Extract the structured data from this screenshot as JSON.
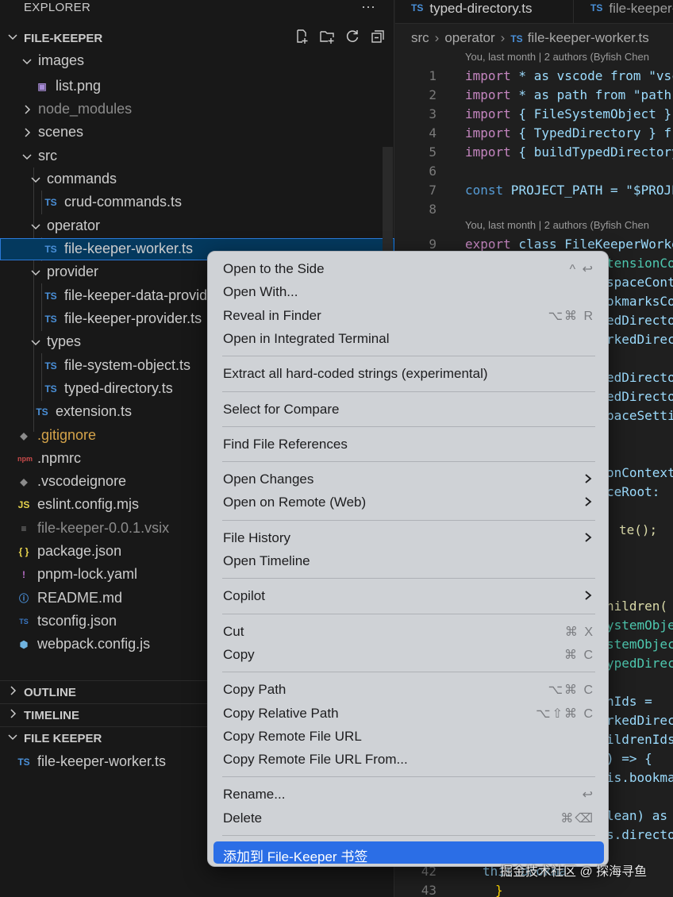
{
  "explorer": {
    "title": "EXPLORER",
    "more_label": "···",
    "root_label": "FILE-KEEPER",
    "tree": [
      {
        "label": "images",
        "type": "folder-open"
      },
      {
        "label": "list.png",
        "type": "image"
      },
      {
        "label": "node_modules",
        "type": "folder-closed",
        "dim": true
      },
      {
        "label": "scenes",
        "type": "folder-closed"
      },
      {
        "label": "src",
        "type": "folder-open"
      },
      {
        "label": "commands",
        "type": "folder-open"
      },
      {
        "label": "crud-commands.ts",
        "type": "ts"
      },
      {
        "label": "operator",
        "type": "folder-open"
      },
      {
        "label": "file-keeper-worker.ts",
        "type": "ts",
        "selected": true
      },
      {
        "label": "provider",
        "type": "folder-open"
      },
      {
        "label": "file-keeper-data-provider.ts",
        "type": "ts"
      },
      {
        "label": "file-keeper-provider.ts",
        "type": "ts"
      },
      {
        "label": "types",
        "type": "folder-open"
      },
      {
        "label": "file-system-object.ts",
        "type": "ts"
      },
      {
        "label": "typed-directory.ts",
        "type": "ts"
      },
      {
        "label": "extension.ts",
        "type": "ts"
      },
      {
        "label": ".gitignore",
        "type": "git"
      },
      {
        "label": ".npmrc",
        "type": "npm"
      },
      {
        "label": ".vscodeignore",
        "type": "git-gray"
      },
      {
        "label": "eslint.config.mjs",
        "type": "js"
      },
      {
        "label": "file-keeper-0.0.1.vsix",
        "type": "text",
        "dim": true
      },
      {
        "label": "package.json",
        "type": "json"
      },
      {
        "label": "pnpm-lock.yaml",
        "type": "yaml"
      },
      {
        "label": "README.md",
        "type": "info"
      },
      {
        "label": "tsconfig.json",
        "type": "tsconfig"
      },
      {
        "label": "webpack.config.js",
        "type": "webpack"
      }
    ],
    "icon_text": {
      "ts": "TS",
      "js": "JS",
      "json": "{ }",
      "yaml": "!",
      "info": "ⓘ",
      "text": "≡",
      "npm": "npm",
      "git": "◆",
      "tsconfig": "TS",
      "webpack": "⬢",
      "image": "▣"
    },
    "sections": {
      "outline": "OUTLINE",
      "timeline": "TIMELINE",
      "file_keeper": "FILE KEEPER",
      "file_keeper_item": "file-keeper-worker.ts"
    }
  },
  "editor": {
    "tabs": [
      {
        "badge": "TS",
        "label": "typed-directory.ts"
      },
      {
        "badge": "TS",
        "label": "file-keeper-worker.ts"
      }
    ],
    "breadcrumb": [
      "src",
      "operator",
      "file-keeper-worker.ts"
    ],
    "breadcrumb_badge": "TS",
    "blame": "You, last month | 2 authors (Byfish Chen",
    "lines": [
      {
        "n": "1",
        "kw": "import",
        "rest": " * as vscode from \"vsc"
      },
      {
        "n": "2",
        "kw": "import",
        "rest": " * as path from \"path\""
      },
      {
        "n": "3",
        "kw": "import",
        "rest": " { FileSystemObject }"
      },
      {
        "n": "4",
        "kw": "import",
        "rest": " { TypedDirectory } f"
      },
      {
        "n": "5",
        "kw": "import",
        "rest": " { buildTypedDirectory"
      },
      {
        "n": "6",
        "kw": "",
        "rest": ""
      },
      {
        "n": "7",
        "kw": "const",
        "rest": " PROJECT_PATH = \"$PROJE"
      },
      {
        "n": "8",
        "kw": "",
        "rest": ""
      },
      {
        "n": "9",
        "kw": "export",
        "rest": " class FileKeeperWorke"
      }
    ],
    "peek_fragments": [
      "tensionCo",
      "spaceCont",
      "okmarksCo",
      "edDirecto",
      "rkedDirec",
      "edDirecto",
      "edDirecto",
      "paceSetti",
      "onContext",
      "ceRoot:",
      "te();",
      "hildren(",
      "ystemObje",
      "stemObjec",
      "ypedDirec",
      "nIds =",
      "rkedDirec",
      "ildrenIds",
      ") => {",
      "is.bookma",
      "lean) as",
      "s.directo"
    ],
    "bottom_lines": [
      {
        "n": "42",
        "text": "this.bookma"
      },
      {
        "n": "43",
        "text": "}"
      }
    ]
  },
  "context_menu": {
    "items": [
      {
        "label": "Open to the Side",
        "shortcut": "^ ↩"
      },
      {
        "label": "Open With...",
        "shortcut": ""
      },
      {
        "label": "Reveal in Finder",
        "shortcut": "⌥⌘ R"
      },
      {
        "label": "Open in Integrated Terminal",
        "shortcut": ""
      },
      {
        "sep": true
      },
      {
        "label": "Extract all hard-coded strings (experimental)",
        "shortcut": ""
      },
      {
        "sep": true
      },
      {
        "label": "Select for Compare",
        "shortcut": ""
      },
      {
        "sep": true
      },
      {
        "label": "Find File References",
        "shortcut": ""
      },
      {
        "sep": true
      },
      {
        "label": "Open Changes",
        "submenu": true
      },
      {
        "label": "Open on Remote (Web)",
        "submenu": true
      },
      {
        "sep": true
      },
      {
        "label": "File History",
        "submenu": true
      },
      {
        "label": "Open Timeline",
        "shortcut": ""
      },
      {
        "sep": true
      },
      {
        "label": "Copilot",
        "submenu": true
      },
      {
        "sep": true
      },
      {
        "label": "Cut",
        "shortcut": "⌘ X"
      },
      {
        "label": "Copy",
        "shortcut": "⌘ C"
      },
      {
        "sep": true
      },
      {
        "label": "Copy Path",
        "shortcut": "⌥⌘ C"
      },
      {
        "label": "Copy Relative Path",
        "shortcut": "⌥⇧⌘ C"
      },
      {
        "label": "Copy Remote File URL",
        "shortcut": ""
      },
      {
        "label": "Copy Remote File URL From...",
        "shortcut": ""
      },
      {
        "sep": true
      },
      {
        "label": "Rename...",
        "shortcut": "↩"
      },
      {
        "label": "Delete",
        "shortcut": "⌘⌫"
      },
      {
        "sep": true
      },
      {
        "label": "添加到 File-Keeper 书签",
        "shortcut": "",
        "highlighted": true
      }
    ]
  },
  "watermark": "掘金技术社区 @ 探海寻鱼",
  "colors": {
    "accent": "#2b6ee6",
    "ts_badge": "#4a90d9",
    "selection": "#04395e"
  }
}
